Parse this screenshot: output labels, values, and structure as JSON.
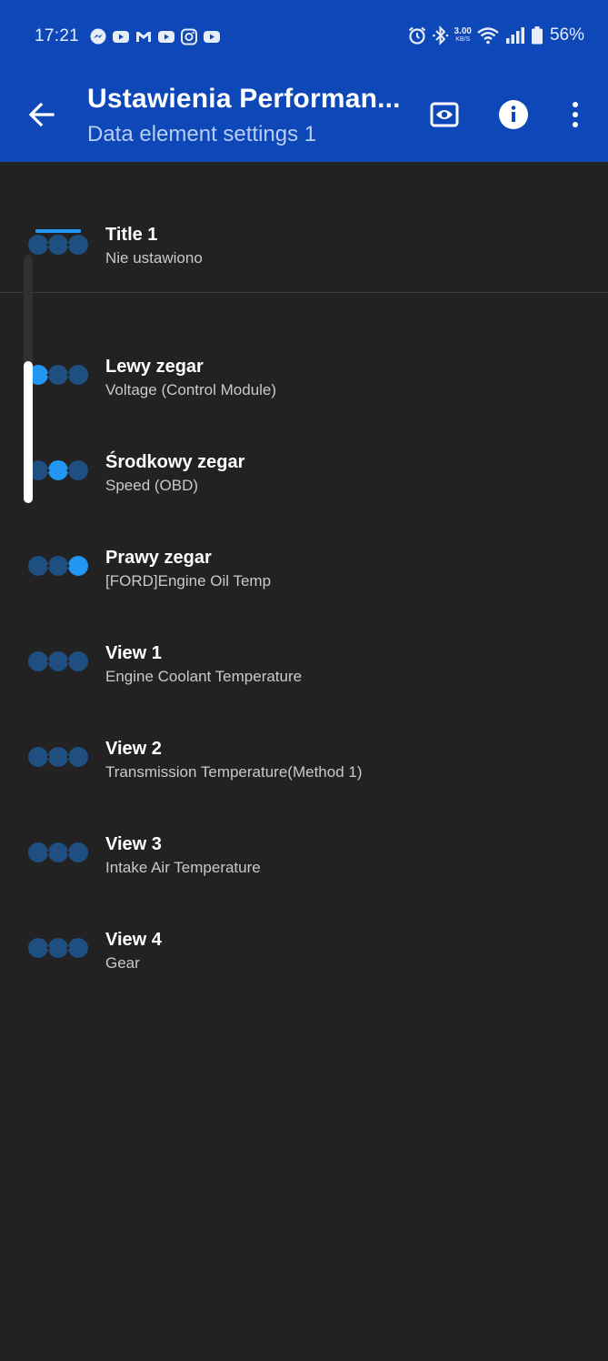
{
  "status_bar": {
    "time": "17:21",
    "notification_icons": [
      "messenger-icon",
      "youtube-icon",
      "gmail-icon",
      "youtube-icon",
      "instagram-icon",
      "youtube-icon"
    ],
    "net_speed_value": "3.00",
    "net_speed_unit": "KB/S",
    "battery_percent": "56%"
  },
  "app_bar": {
    "title": "Ustawienia Performan...",
    "subtitle": "Data element settings 1",
    "actions": [
      "back-icon",
      "preview-eye-icon",
      "info-icon",
      "more-vert-icon"
    ]
  },
  "colors": {
    "app_bar_bg": "#0d47b8",
    "background": "#222222",
    "accent_dot": "#2196f3",
    "dim_dot": "#1f4f80"
  },
  "items": [
    {
      "title": "Title 1",
      "subtitle": "Nie ustawiono",
      "highlight": "bar"
    },
    {
      "title": "Lewy zegar",
      "subtitle": "Voltage (Control Module)",
      "highlight": 0
    },
    {
      "title": "Środkowy zegar",
      "subtitle": "Speed (OBD)",
      "highlight": 1
    },
    {
      "title": "Prawy zegar",
      "subtitle": "[FORD]Engine Oil Temp",
      "highlight": 2
    },
    {
      "title": "View 1",
      "subtitle": "Engine Coolant Temperature",
      "highlight": "none"
    },
    {
      "title": "View 2",
      "subtitle": "Transmission Temperature(Method 1)",
      "highlight": "none"
    },
    {
      "title": "View 3",
      "subtitle": "Intake Air Temperature",
      "highlight": "none"
    },
    {
      "title": "View 4",
      "subtitle": "Gear",
      "highlight": "none"
    }
  ]
}
